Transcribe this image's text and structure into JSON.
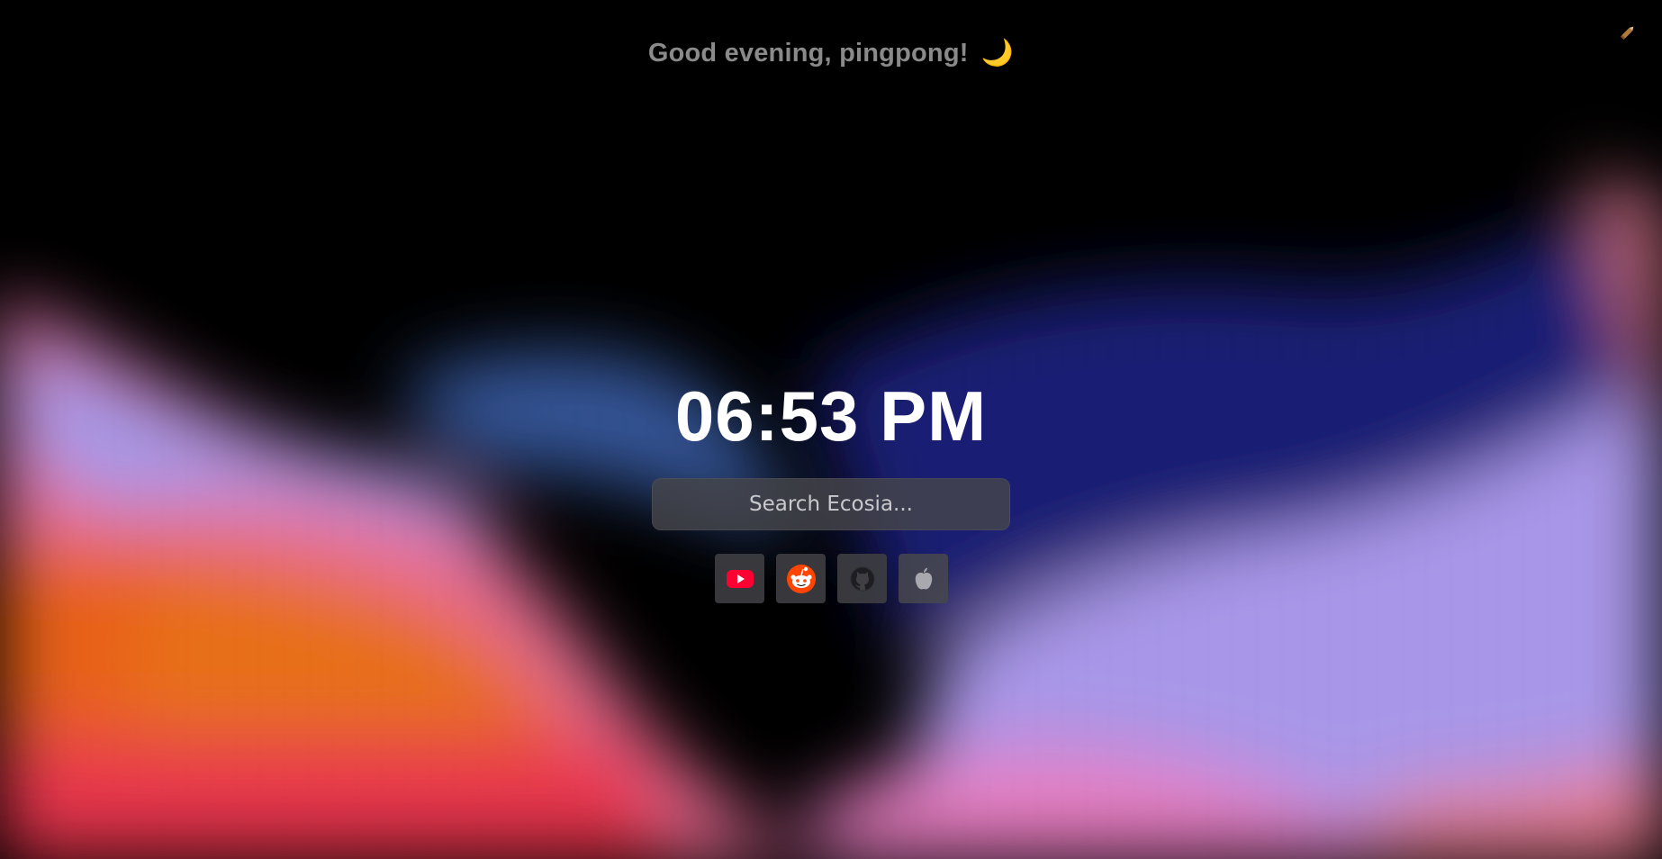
{
  "greeting": {
    "text": "Good evening, pingpong!",
    "emoji": "🌙"
  },
  "clock": {
    "time": "06:53 PM"
  },
  "search": {
    "placeholder": "Search Ecosia..."
  },
  "shortcuts": [
    {
      "name": "YouTube",
      "icon": "youtube-icon"
    },
    {
      "name": "Reddit",
      "icon": "reddit-icon"
    },
    {
      "name": "GitHub",
      "icon": "github-icon"
    },
    {
      "name": "Apple",
      "icon": "apple-icon"
    }
  ],
  "edit": {
    "icon": "pencil-icon"
  },
  "colors": {
    "orange": "#ff6a1a",
    "pink": "#ff7ab8",
    "lavender": "#b7a8ff",
    "navy": "#1a1d6e",
    "youtube_red": "#ff0033",
    "reddit_orange": "#ff4500"
  }
}
